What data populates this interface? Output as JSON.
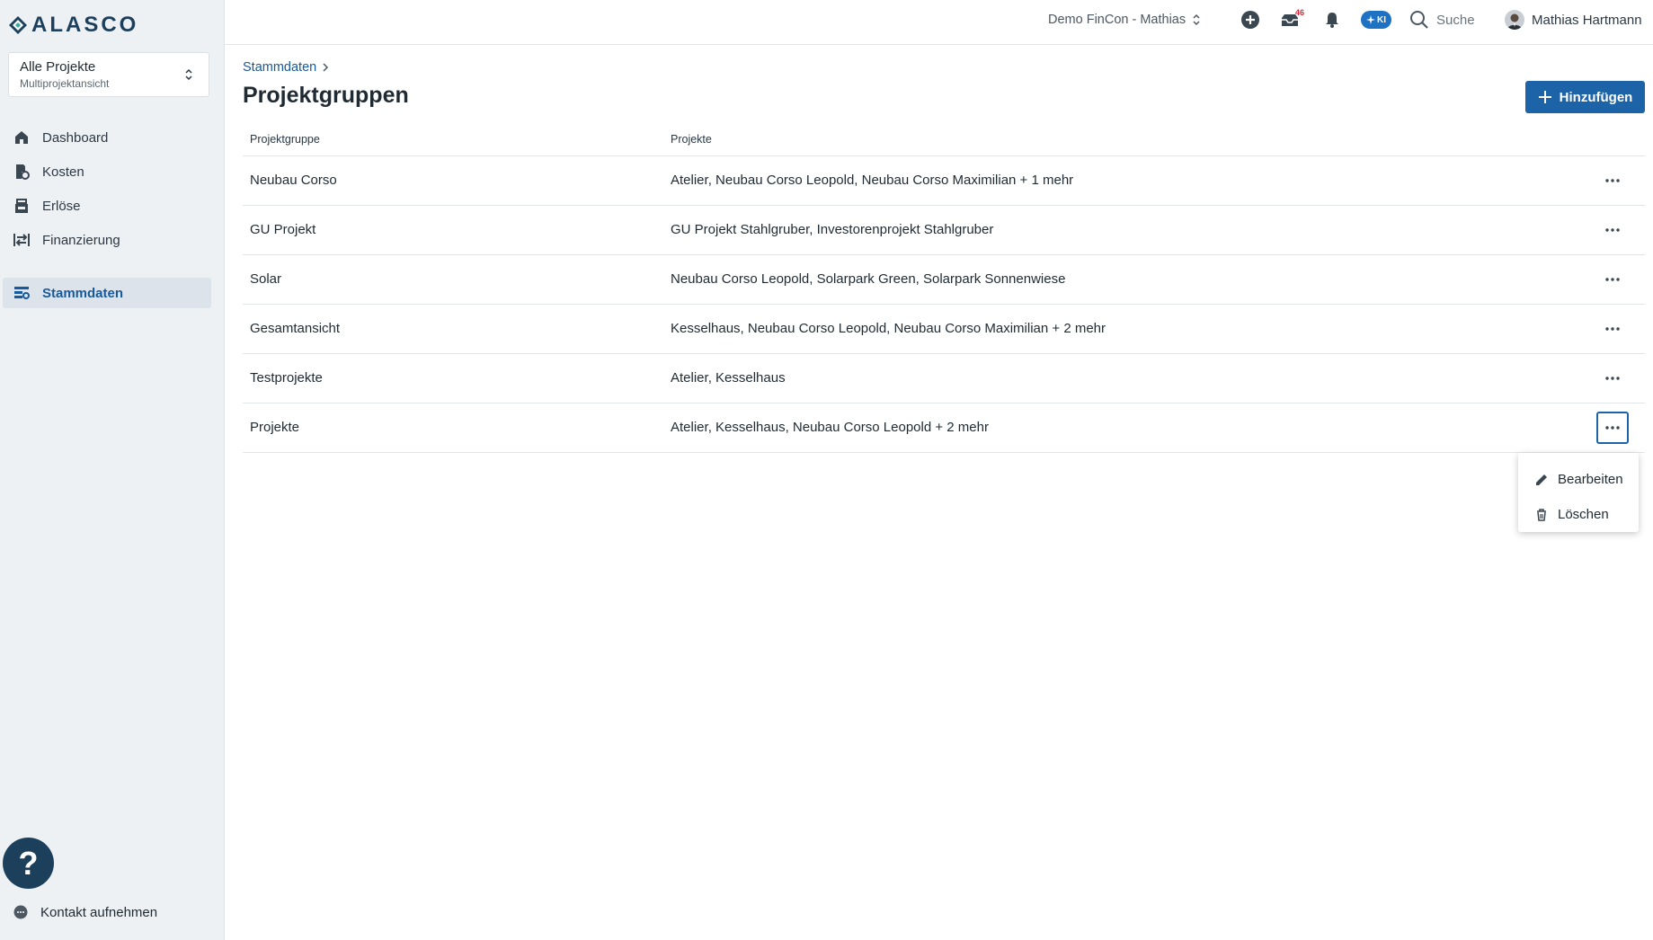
{
  "app": {
    "logo_text": "ALASCO"
  },
  "sidebar": {
    "project_select": {
      "title": "Alle Projekte",
      "subtitle": "Multiprojektansicht"
    },
    "items": [
      {
        "label": "Dashboard",
        "icon": "home-icon"
      },
      {
        "label": "Kosten",
        "icon": "costs-icon"
      },
      {
        "label": "Erlöse",
        "icon": "revenue-icon"
      },
      {
        "label": "Finanzierung",
        "icon": "financing-icon"
      },
      {
        "label": "Stammdaten",
        "icon": "master-data-icon",
        "active": true
      }
    ],
    "help_label": "?",
    "contact_label": "Kontakt aufnehmen"
  },
  "topbar": {
    "tenant": "Demo FinCon - Mathias",
    "notification_count": "46",
    "ki_label": "KI",
    "search_label": "Suche",
    "user_name": "Mathias Hartmann"
  },
  "main": {
    "breadcrumb": "Stammdaten",
    "title": "Projektgruppen",
    "add_button": "Hinzufügen",
    "columns": [
      "Projektgruppe",
      "Projekte"
    ],
    "rows": [
      {
        "group": "Neubau Corso",
        "projects": "Atelier, Neubau Corso Leopold, Neubau Corso Maximilian + 1 mehr"
      },
      {
        "group": "GU Projekt",
        "projects": "GU Projekt Stahlgruber, Investorenprojekt Stahlgruber"
      },
      {
        "group": "Solar",
        "projects": "Neubau Corso Leopold, Solarpark Green, Solarpark Sonnenwiese"
      },
      {
        "group": "Gesamtansicht",
        "projects": "Kesselhaus, Neubau Corso Leopold, Neubau Corso Maximilian + 2 mehr"
      },
      {
        "group": "Testprojekte",
        "projects": "Atelier, Kesselhaus"
      },
      {
        "group": "Projekte",
        "projects": "Atelier, Kesselhaus, Neubau Corso Leopold + 2 mehr"
      }
    ],
    "context_menu": {
      "edit": "Bearbeiten",
      "delete": "Löschen"
    }
  },
  "colors": {
    "brand": "#1c3f5c",
    "accent": "#1d63a8",
    "active_nav": "#17599a",
    "badge": "#d9263a"
  }
}
